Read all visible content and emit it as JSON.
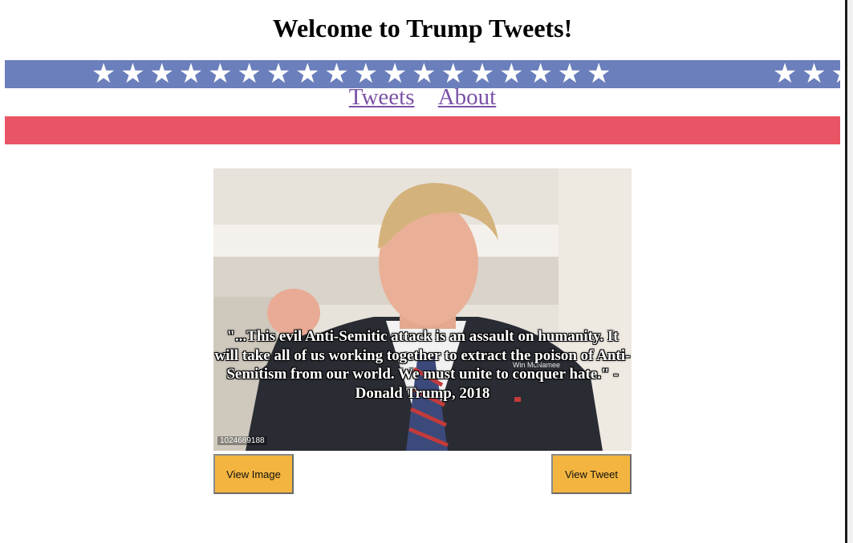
{
  "header": {
    "title": "Welcome to Trump Tweets!"
  },
  "banner": {
    "star_glyph": "★",
    "stars_left_count": 18,
    "stars_right_count": 3,
    "blue_color": "#6a7fbb",
    "red_color": "#e95564"
  },
  "nav": {
    "items": [
      {
        "label": "Tweets"
      },
      {
        "label": "About"
      }
    ],
    "link_color": "#7b52a6"
  },
  "card": {
    "quote": "\"...This evil Anti-Semitic attack is an assault on humanity. It will take all of us working together to extract the poison of Anti-Semitism from our world. We must unite to conquer hate.\" - Donald Trump, 2018",
    "photo_id": "1024689188",
    "photo_credit": "Win McNamee",
    "view_image_label": "View Image",
    "view_tweet_label": "View Tweet",
    "button_color": "#f3b53f"
  }
}
